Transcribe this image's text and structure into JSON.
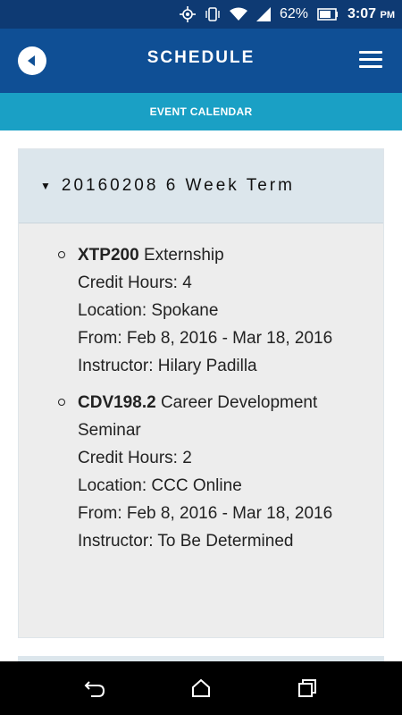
{
  "status_bar": {
    "battery": "62%",
    "time": "3:07",
    "ampm": "PM"
  },
  "app_bar": {
    "title": "SCHEDULE"
  },
  "sub_bar": {
    "label": "EVENT CALENDAR"
  },
  "term": {
    "title": "20160208 6 Week Term",
    "courses": [
      {
        "code": "XTP200",
        "name": "Externship",
        "credit_hours": "Credit Hours: 4",
        "location": "Location: Spokane",
        "dates": "From: Feb 8, 2016 - Mar 18, 2016",
        "instructor": "Instructor: Hilary Padilla"
      },
      {
        "code": "CDV198.2",
        "name": "Career Development Seminar",
        "credit_hours": "Credit Hours: 2",
        "location": "Location: CCC Online",
        "dates": "From: Feb 8, 2016 - Mar 18, 2016",
        "instructor": "Instructor: To Be Determined"
      }
    ]
  },
  "icons": {
    "back": "back-arrow-icon",
    "menu": "hamburger-menu-icon",
    "nav_back": "nav-back-icon",
    "nav_home": "nav-home-icon",
    "nav_recents": "nav-recents-icon"
  },
  "colors": {
    "status_bar": "#0e3a73",
    "app_bar": "#0f4f95",
    "sub_bar": "#1aa0c5",
    "card_header": "#dce6ec",
    "card_body": "#ededed"
  }
}
